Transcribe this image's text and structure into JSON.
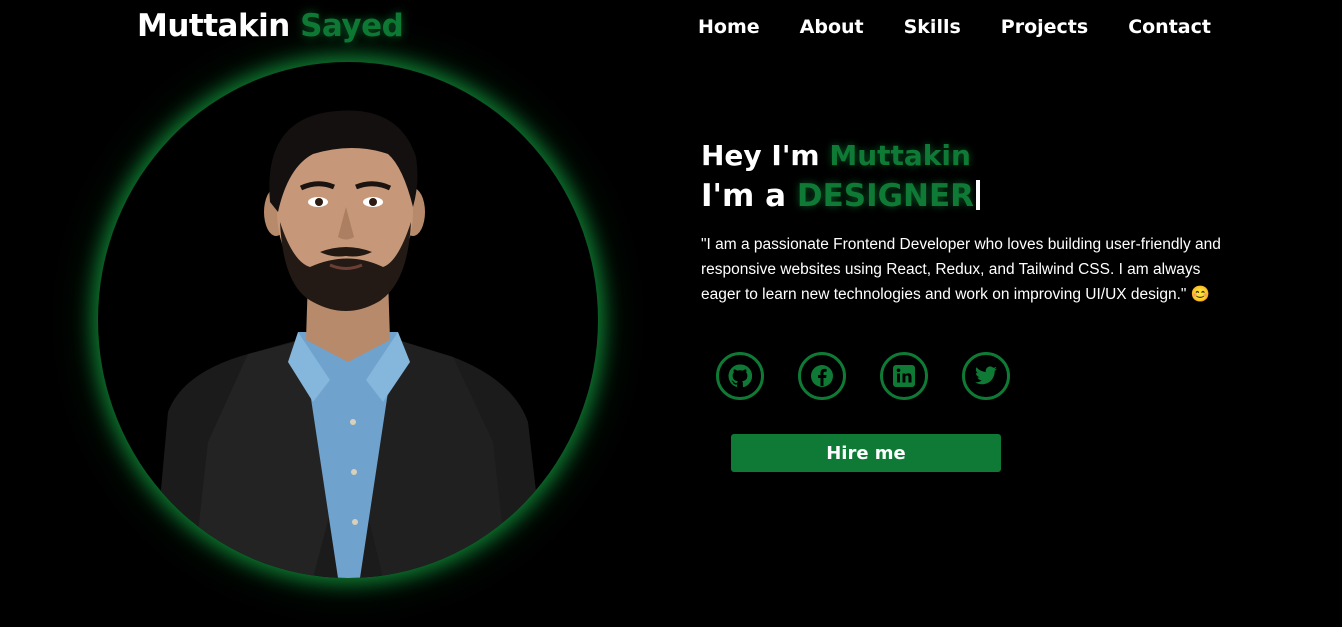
{
  "header": {
    "logo_first": "Muttakin",
    "logo_second": "Sayed",
    "nav": [
      {
        "label": "Home"
      },
      {
        "label": "About"
      },
      {
        "label": "Skills"
      },
      {
        "label": "Projects"
      },
      {
        "label": "Contact"
      }
    ]
  },
  "hero": {
    "greet_prefix": "Hey I'm ",
    "greet_name": "Muttakin",
    "role_prefix": "I'm a ",
    "role_word": "DESIGNER",
    "bio": "\"I am a passionate Frontend Developer who loves building user-friendly and responsive websites using React, Redux, and Tailwind CSS. I am always eager to learn new technologies and work on improving UI/UX design.\" 😊",
    "socials": [
      {
        "icon": "github-icon"
      },
      {
        "icon": "facebook-icon"
      },
      {
        "icon": "linkedin-icon"
      },
      {
        "icon": "twitter-icon"
      }
    ],
    "cta_label": "Hire me"
  },
  "colors": {
    "background": "#000000",
    "accent": "#0e7a35",
    "text": "#ffffff"
  }
}
